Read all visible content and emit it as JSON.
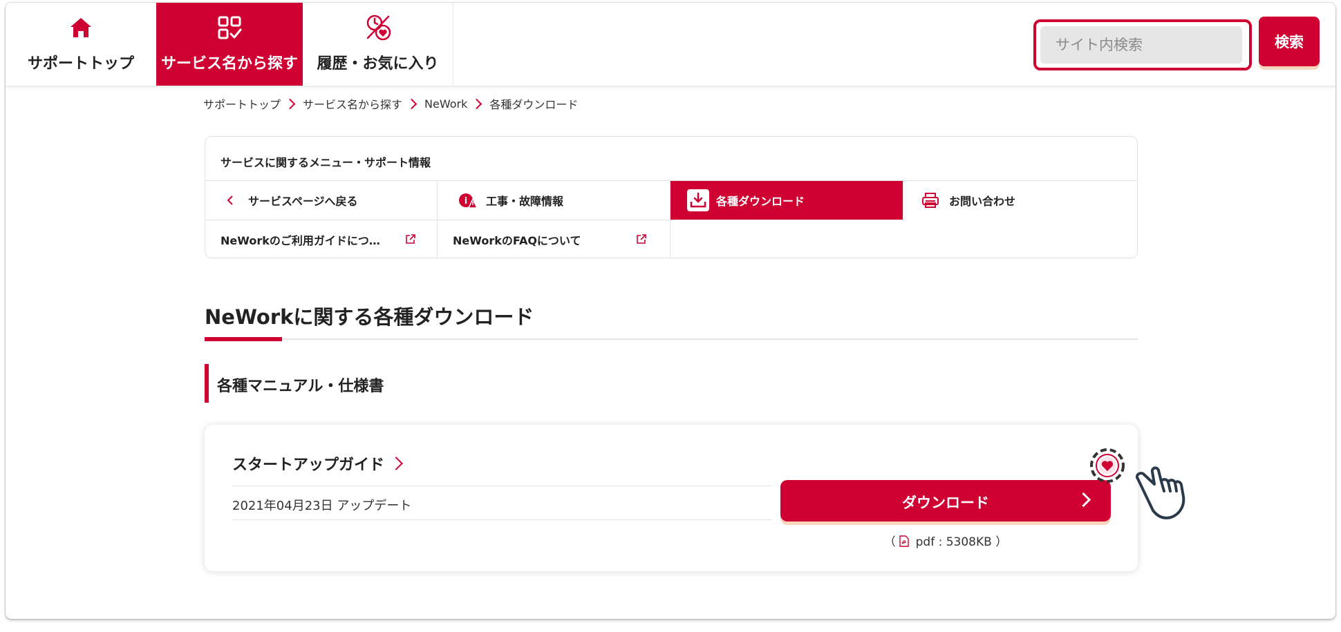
{
  "header": {
    "nav": [
      {
        "label": "サポートトップ",
        "icon": "home-icon"
      },
      {
        "label": "サービス名から探す",
        "icon": "grid-check-icon",
        "active": true
      },
      {
        "label": "履歴・お気に入り",
        "icon": "history-heart-icon"
      }
    ],
    "search": {
      "placeholder": "サイト内検索",
      "value": "",
      "button_label": "検索"
    }
  },
  "breadcrumb": [
    "サポートトップ",
    "サービス名から探す",
    "NeWork",
    "各種ダウンロード"
  ],
  "service_menu": {
    "title": "サービスに関するメニュー・サポート情報",
    "items": [
      {
        "label": "サービスページへ戻る",
        "icon": "chevron-left-icon"
      },
      {
        "label": "工事・故障情報",
        "icon": "warning-info-icon"
      },
      {
        "label": "各種ダウンロード",
        "icon": "download-icon",
        "active": true
      },
      {
        "label": "お問い合わせ",
        "icon": "printer-icon"
      },
      {
        "label": "NeWorkのご利用ガイドにつ…",
        "icon": "external-link-icon"
      },
      {
        "label": "NeWorkのFAQについて",
        "icon": "external-link-icon"
      }
    ]
  },
  "page": {
    "title": "NeWorkに関する各種ダウンロード",
    "section_title": "各種マニュアル・仕様書"
  },
  "card": {
    "title": "スタートアップガイド",
    "update": "2021年04月23日 アップデート",
    "download_label": "ダウンロード",
    "file_info_open": "（",
    "file_info": "pdf : 5308KB",
    "file_info_close": "）"
  },
  "colors": {
    "brand": "#cf0032",
    "button_shadow": "#f6d6bf"
  }
}
